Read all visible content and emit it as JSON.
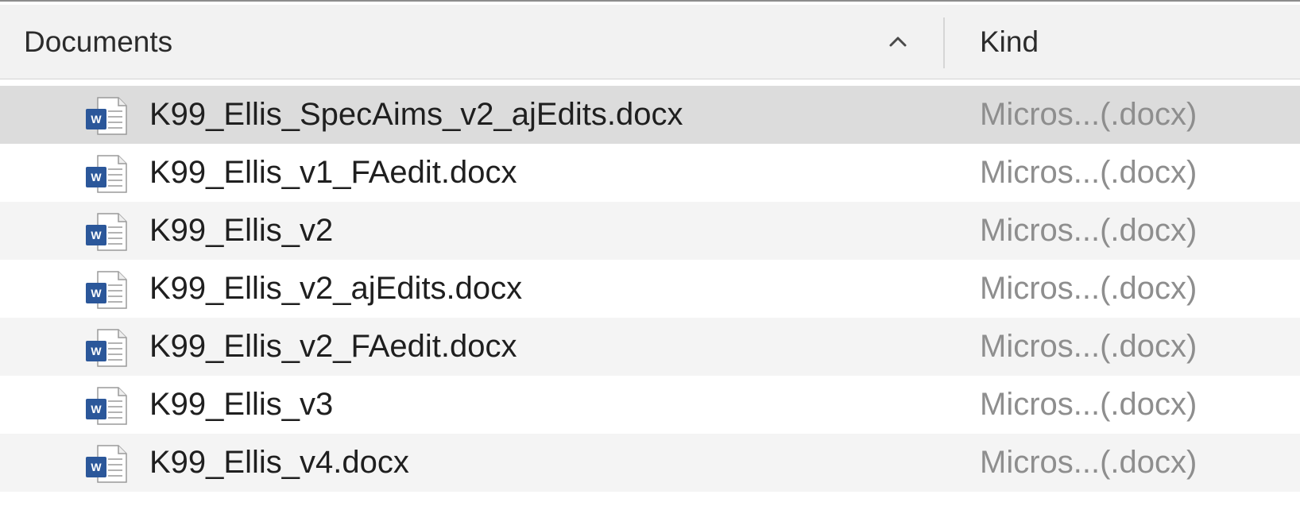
{
  "columns": {
    "name_header": "Documents",
    "kind_header": "Kind",
    "sort_direction": "ascending"
  },
  "colors": {
    "selected_row": "#dcdcdc",
    "alternate_row": "#f4f4f4",
    "word_icon_blue": "#2b579a"
  },
  "files": [
    {
      "name": "K99_Ellis_SpecAims_v2_ajEdits.docx",
      "kind": "Micros...(.docx)",
      "icon": "word-document-icon",
      "selected": true
    },
    {
      "name": "K99_Ellis_v1_FAedit.docx",
      "kind": "Micros...(.docx)",
      "icon": "word-document-icon",
      "selected": false
    },
    {
      "name": "K99_Ellis_v2",
      "kind": "Micros...(.docx)",
      "icon": "word-document-icon",
      "selected": false
    },
    {
      "name": "K99_Ellis_v2_ajEdits.docx",
      "kind": "Micros...(.docx)",
      "icon": "word-document-icon",
      "selected": false
    },
    {
      "name": "K99_Ellis_v2_FAedit.docx",
      "kind": "Micros...(.docx)",
      "icon": "word-document-icon",
      "selected": false
    },
    {
      "name": "K99_Ellis_v3",
      "kind": "Micros...(.docx)",
      "icon": "word-document-icon",
      "selected": false
    },
    {
      "name": "K99_Ellis_v4.docx",
      "kind": "Micros...(.docx)",
      "icon": "word-document-icon",
      "selected": false
    }
  ]
}
